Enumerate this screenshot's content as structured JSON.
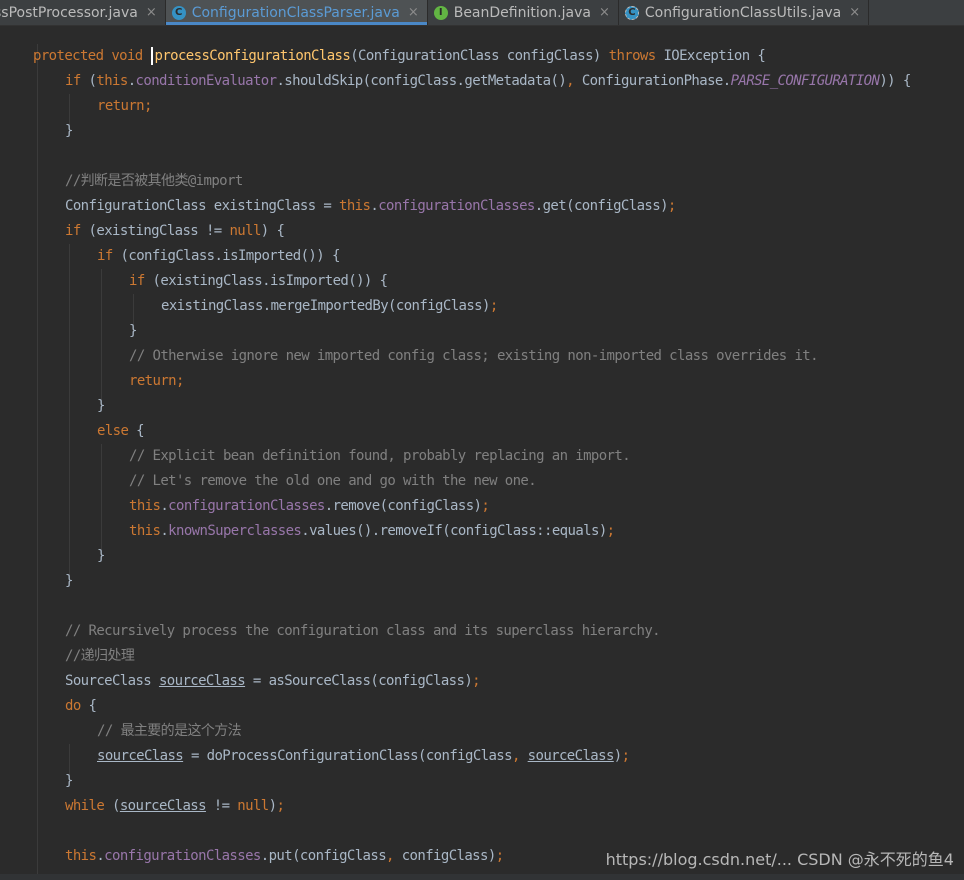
{
  "tabs": [
    {
      "label": "ssPostProcessor.java",
      "icon": "class-icon",
      "active": false
    },
    {
      "label": "ConfigurationClassParser.java",
      "icon": "class-icon",
      "active": true
    },
    {
      "label": "BeanDefinition.java",
      "icon": "interface-icon",
      "active": false
    },
    {
      "label": "ConfigurationClassUtils.java",
      "icon": "abstract-class-icon",
      "active": false
    }
  ],
  "tab_close_glyph": "×",
  "icon_letters": {
    "class": "C",
    "interface": "I",
    "abstract": "C"
  },
  "code": {
    "l1": {
      "kw1": "protected",
      "kw2": "void",
      "method": "processConfigurationClass",
      "open": "(",
      "params": "ConfigurationClass configClass",
      "close": ")",
      "throws": "throws",
      "exception": "IOException",
      "brace": "{"
    },
    "l2": {
      "kw": "if",
      "open": "(",
      "this": "this",
      "dot1": ".",
      "field": "conditionEvaluator",
      "call": ".shouldSkip",
      "p1": "(",
      "arg1": "configClass.getMetadata",
      "p2": "()",
      "comma": ",",
      "arg2": " ConfigurationPhase.",
      "const": "PARSE_CONFIGURATION",
      "p3": ")",
      "p4": ")",
      "brace": "{"
    },
    "l3": {
      "kw": "return",
      "semi": ";"
    },
    "l4": {
      "brace": "}"
    },
    "l6": {
      "comment": "//判断是否被其他类@import"
    },
    "l7": {
      "type": "ConfigurationClass existingClass = ",
      "this": "this",
      "dot": ".",
      "field": "configurationClasses",
      "call": ".get",
      "p1": "(",
      "arg": "configClass",
      "p2": ")",
      "semi": ";"
    },
    "l8": {
      "kw": "if",
      "open": "(",
      "expr": "existingClass != ",
      "null": "null",
      "close": ")",
      "brace": "{"
    },
    "l9": {
      "kw": "if",
      "open": "(",
      "call": "configClass.isImported",
      "p": "()",
      "close": ")",
      "brace": "{"
    },
    "l10": {
      "kw": "if",
      "open": "(",
      "call": "existingClass.isImported",
      "p": "()",
      "close": ")",
      "brace": "{"
    },
    "l11": {
      "call": "existingClass.mergeImportedBy",
      "p1": "(",
      "arg": "configClass",
      "p2": ")",
      "semi": ";"
    },
    "l12": {
      "brace": "}"
    },
    "l13": {
      "comment": "// Otherwise ignore new imported config class; existing non-imported class overrides it."
    },
    "l14": {
      "kw": "return",
      "semi": ";"
    },
    "l15": {
      "brace": "}"
    },
    "l16": {
      "kw": "else",
      "brace": "{"
    },
    "l17": {
      "comment": "// Explicit bean definition found, probably replacing an import."
    },
    "l18": {
      "comment": "// Let's remove the old one and go with the new one."
    },
    "l19": {
      "this": "this",
      "dot": ".",
      "field": "configurationClasses",
      "call": ".remove",
      "p1": "(",
      "arg": "configClass",
      "p2": ")",
      "semi": ";"
    },
    "l20": {
      "this": "this",
      "dot": ".",
      "field": "knownSuperclasses",
      "call": ".values",
      "p": "()",
      "call2": ".removeIf",
      "p1": "(",
      "arg": "configClass::equals",
      "p2": ")",
      "semi": ";"
    },
    "l21": {
      "brace": "}"
    },
    "l22": {
      "brace": "}"
    },
    "l24": {
      "comment": "// Recursively process the configuration class and its superclass hierarchy."
    },
    "l25": {
      "comment": "//递归处理"
    },
    "l26": {
      "type": "SourceClass ",
      "var": "sourceClass",
      "eq": " = asSourceClass",
      "p1": "(",
      "arg": "configClass",
      "p2": ")",
      "semi": ";"
    },
    "l27": {
      "kw": "do",
      "brace": "{"
    },
    "l28": {
      "comment": "// 最主要的是这个方法"
    },
    "l29": {
      "var": "sourceClass",
      "eq": " = doProcessConfigurationClass",
      "p1": "(",
      "arg1": "configClass",
      "comma": ",",
      "sp": " ",
      "var2": "sourceClass",
      "p2": ")",
      "semi": ";"
    },
    "l30": {
      "brace": "}"
    },
    "l31": {
      "kw": "while",
      "open": "(",
      "var": "sourceClass",
      "expr": " != ",
      "null": "null",
      "close": ")",
      "semi": ";"
    },
    "l33": {
      "this": "this",
      "dot": ".",
      "field": "configurationClasses",
      "call": ".put",
      "p1": "(",
      "arg1": "configClass",
      "comma": ",",
      "arg2": " configClass",
      "p2": ")",
      "semi": ";"
    }
  },
  "watermark": "https://blog.csdn.net/... CSDN @永不死的鱼4"
}
